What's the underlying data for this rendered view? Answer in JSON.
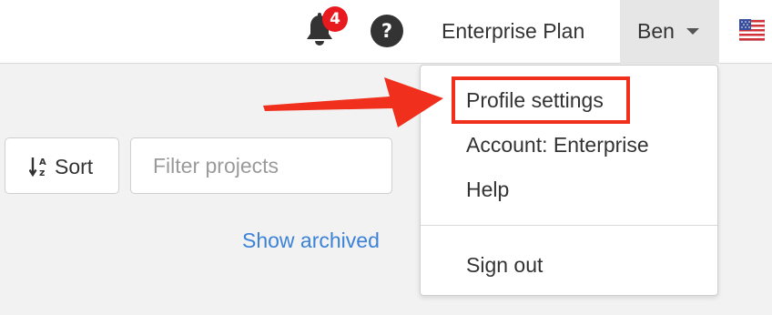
{
  "header": {
    "notification_count": "4",
    "help_glyph": "?",
    "plan_label": "Enterprise Plan",
    "user_name": "Ben",
    "icons": {
      "notifications": "bell-icon",
      "help": "question-circle-icon",
      "user_menu_caret": "caret-down-icon",
      "language": "us-flag-icon"
    }
  },
  "toolbar": {
    "sort_label": "Sort",
    "sort_icon": "sort-alpha-icon",
    "filter_placeholder": "Filter projects",
    "filter_value": "",
    "show_archived_label": "Show archived"
  },
  "user_menu": {
    "items": [
      {
        "label": "Profile settings",
        "highlighted": true
      },
      {
        "label": "Account: Enterprise"
      },
      {
        "label": "Help"
      }
    ],
    "sign_out_label": "Sign out"
  },
  "annotation": {
    "arrow_color": "#f0301d",
    "highlight_color": "#f0301d"
  },
  "colors": {
    "badge": "#e8191f",
    "link": "#3b82d8",
    "active_button_bg": "#e6e6e6"
  }
}
